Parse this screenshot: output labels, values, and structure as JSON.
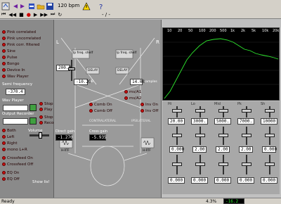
{
  "toolbar": {
    "tempo": "120 bpm",
    "position": "- / -"
  },
  "left": {
    "noise": [
      "Pink correlated",
      "Pink uncorrelated",
      "Pink corr. filtered",
      "Sine",
      "Pulse",
      "Bongo",
      "Device In",
      "Wav Player"
    ],
    "semitone_label": "Semi frequency",
    "semitone_value": "-370.4",
    "wav_player_label": "Wav Player",
    "play_controls": [
      "Stop",
      "Play"
    ],
    "output_recorder_label": "Output Recorder",
    "rec_controls": [
      "Stop",
      "Record"
    ],
    "volume_label": "Volume",
    "channels": [
      "Both",
      "Left",
      "Right",
      "mono L+R"
    ],
    "bottom": [
      "Crossfeed On",
      "Crossfeed Off",
      "EQ On",
      "EQ Off"
    ],
    "show_button": "Show lis!"
  },
  "center": {
    "L": "L",
    "R": "R",
    "value_a": "200.0",
    "value_b": "-10.20",
    "value_c": "14.00",
    "samples_label": "samples",
    "delay_left": "DELAY",
    "delay_right": "DELAY",
    "lp_left": "lp freq. shelf",
    "lp_right": "lp freq. shelf",
    "comb_on": "Comb On",
    "comb_off": "Comb Off",
    "inv_on": "Inv On",
    "inv_off": "Inv Off",
    "ms_a": "ms/A1",
    "ms_b": "ms/A2",
    "contralateral": "CONTRALATERAL",
    "ipsilateral": "IPSILATERAL",
    "direct_gain_label": "Direct gain",
    "cross_gain_label": "Cross gain",
    "direct_gain": "-1.270",
    "cross_gain": "-5.935",
    "hrtf_l": "H-RTF",
    "hrtf_r": "H-RTF"
  },
  "spectrum": {
    "ticks": [
      "10",
      "20",
      "50",
      "100",
      "200",
      "500",
      "1k",
      "2k",
      "5k",
      "10k",
      "20k"
    ]
  },
  "eq": {
    "bands": [
      {
        "label": "Hi",
        "freq": "20.00",
        "q": "0.000"
      },
      {
        "label": "Lo",
        "freq": "3000.",
        "q": "2.00"
      },
      {
        "label": "Mid",
        "freq": "5000.",
        "q": "2.00"
      },
      {
        "label": "Pk",
        "freq": "7000.",
        "q": "2.00"
      },
      {
        "label": "Sh",
        "freq": "10000",
        "q": "0.000"
      }
    ],
    "gains": [
      "0.000",
      "0.000",
      "0.000",
      "0.000",
      "0.000"
    ]
  },
  "status": {
    "ready": "Ready",
    "cpu": "4.3%",
    "level": "-16.2 dB"
  },
  "colors": {
    "led_red": "#c81010",
    "spectrum_line": "#2ee82e"
  }
}
